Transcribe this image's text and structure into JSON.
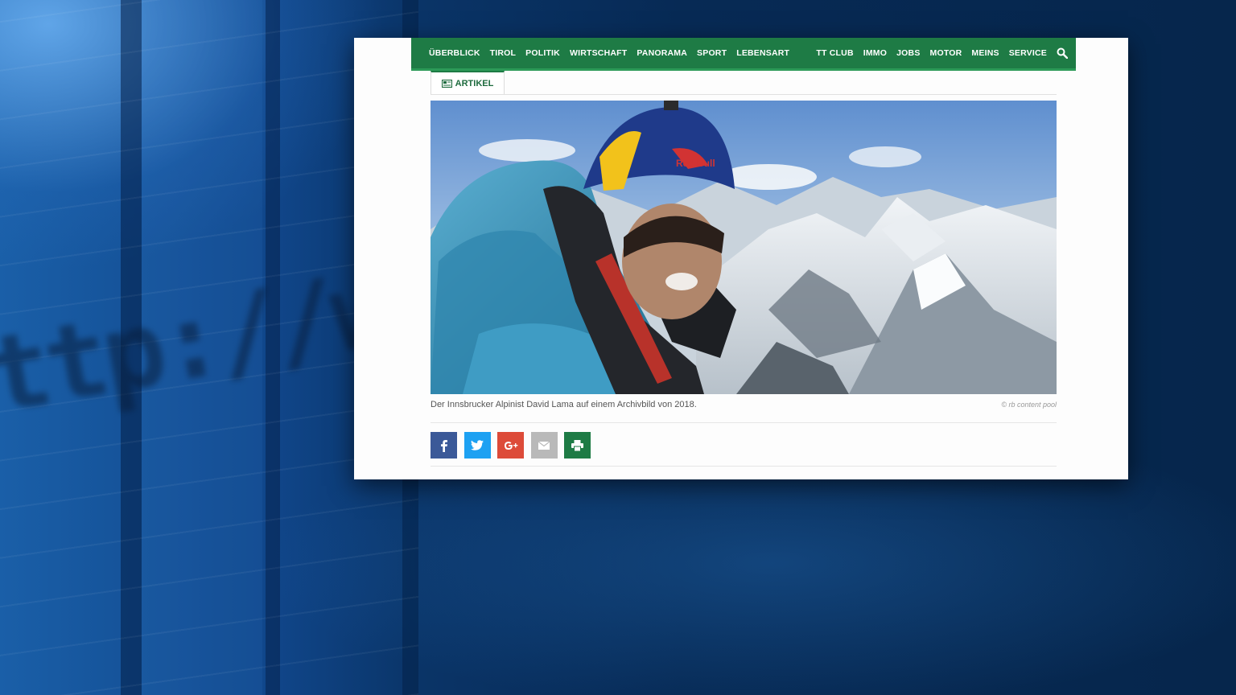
{
  "nav": {
    "left_items": [
      "ÜBERBLICK",
      "TIROL",
      "POLITIK",
      "WIRTSCHAFT",
      "PANORAMA",
      "SPORT",
      "LEBENSART"
    ],
    "right_items": [
      "TT CLUB",
      "IMMO",
      "JOBS",
      "MOTOR",
      "MEINS",
      "SERVICE"
    ],
    "search_icon": "search-icon"
  },
  "tab": {
    "label": "ARTIKEL",
    "icon": "article-icon"
  },
  "photo": {
    "helmet_text": "Red Bull"
  },
  "caption": "Der Innsbrucker Alpinist David Lama auf einem Archivbild von 2018.",
  "credit": "© rb content pool",
  "share": [
    {
      "name": "facebook",
      "icon": "facebook-icon",
      "color": "#3b5998"
    },
    {
      "name": "twitter",
      "icon": "twitter-icon",
      "color": "#1da1f2"
    },
    {
      "name": "google-plus",
      "icon": "google-plus-icon",
      "color": "#dd4b39"
    },
    {
      "name": "email",
      "icon": "mail-icon",
      "color": "#b9b9b9"
    },
    {
      "name": "print",
      "icon": "print-icon",
      "color": "#1e7b45"
    }
  ],
  "colors": {
    "brand_green": "#1e7b45",
    "background_blue": "#06254a"
  }
}
